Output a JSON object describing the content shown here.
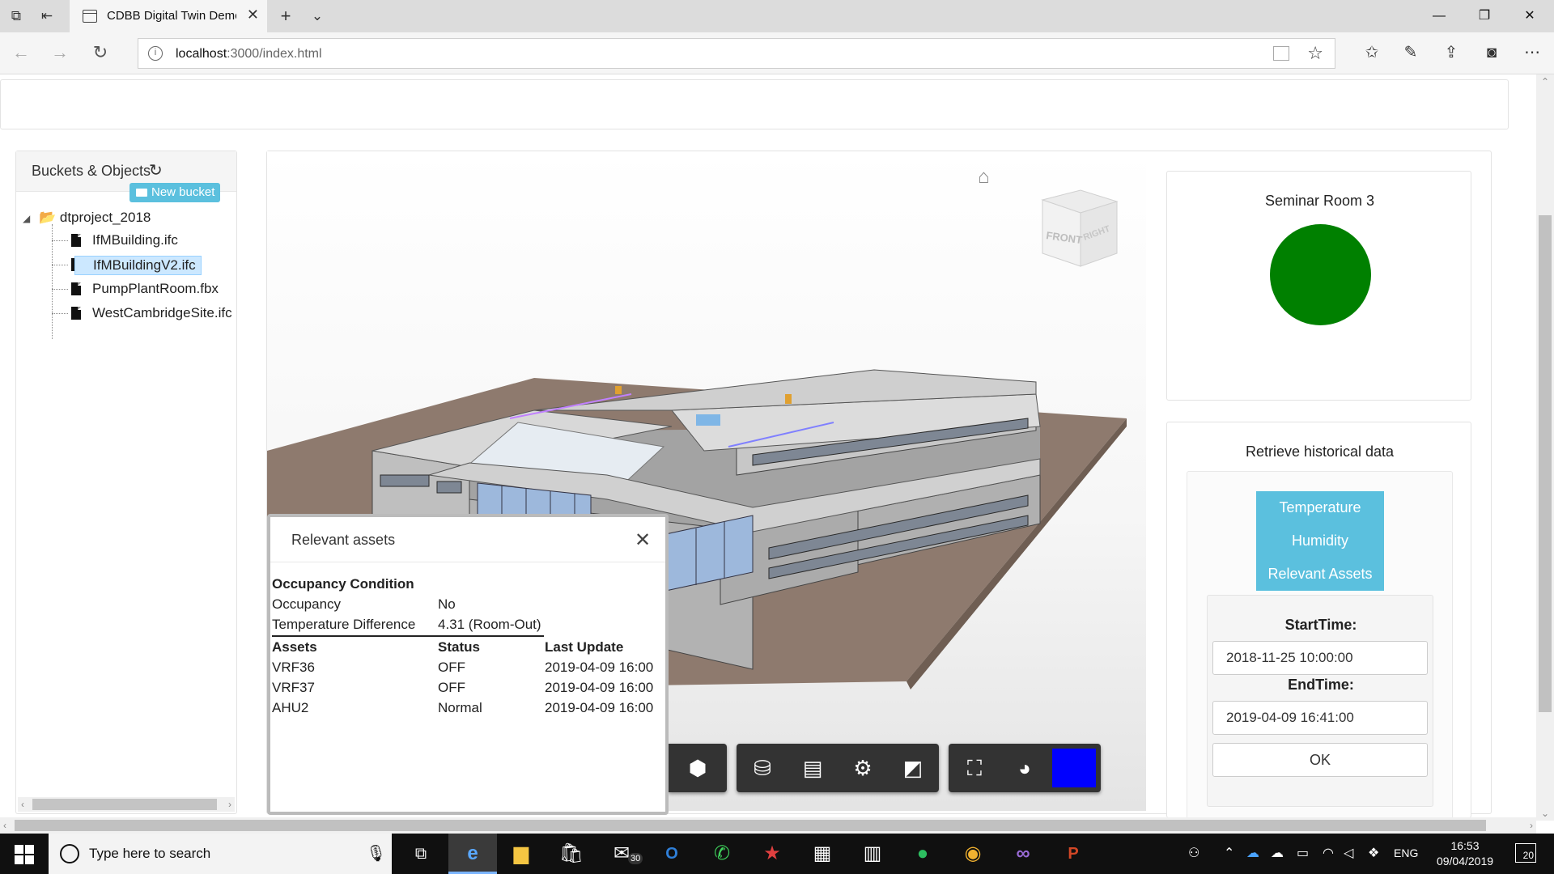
{
  "browser": {
    "tab_title": "CDBB Digital Twin Demo",
    "url": "localhost:3000/index.html",
    "url_host": "localhost",
    "url_rest": ":3000/index.html"
  },
  "left_panel": {
    "title": "Buckets & Objects",
    "new_bucket_label": "New bucket",
    "root": "dtproject_2018",
    "files": [
      "IfMBuilding.ifc",
      "IfMBuildingV2.ifc",
      "PumpPlantRoom.fbx",
      "WestCambridgeSite.ifc"
    ],
    "selected_index": 1
  },
  "viewer": {
    "viewcube_front": "FRONT",
    "viewcube_right": "RIGHT",
    "swatch_color": "#0000ff"
  },
  "assets_panel": {
    "title": "Relevant assets",
    "section_title": "Occupancy Condition",
    "occupancy_label": "Occupancy",
    "occupancy_value": "No",
    "temp_diff_label": "Temperature Difference",
    "temp_diff_value": "4.31 (Room-Out)",
    "columns": [
      "Assets",
      "Status",
      "Last Update"
    ],
    "rows": [
      [
        "VRF36",
        "OFF",
        "2019-04-09 16:00"
      ],
      [
        "VRF37",
        "OFF",
        "2019-04-09 16:00"
      ],
      [
        "AHU2",
        "Normal",
        "2019-04-09 16:00"
      ]
    ]
  },
  "status_panel": {
    "room_name": "Seminar Room 3",
    "indicator_color": "#008000"
  },
  "history_panel": {
    "title": "Retrieve historical data",
    "buttons": [
      "Temperature",
      "Humidity",
      "Relevant Assets"
    ],
    "start_label": "StartTime:",
    "start_value": "2018-11-25 10:00:00",
    "end_label": "EndTime:",
    "end_value": "2019-04-09 16:41:00",
    "ok_label": "OK"
  },
  "taskbar": {
    "search_placeholder": "Type here to search",
    "mail_badge": "30",
    "language": "ENG",
    "time": "16:53",
    "date": "09/04/2019",
    "notification_count": "20"
  }
}
